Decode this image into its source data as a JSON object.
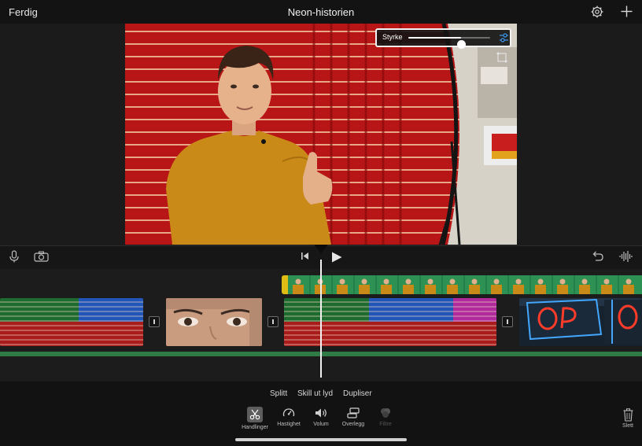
{
  "header": {
    "done_label": "Ferdig",
    "title": "Neon-historien"
  },
  "viewer": {
    "strength_label": "Styrke",
    "strength_value": 0.64
  },
  "clip_actions": [
    "Splitt",
    "Skill ut lyd",
    "Dupliser"
  ],
  "tools": [
    {
      "label": "Handlinger",
      "icon": "scissors-icon",
      "selected": true,
      "enabled": true
    },
    {
      "label": "Hastighet",
      "icon": "speedometer-icon",
      "selected": false,
      "enabled": true
    },
    {
      "label": "Volum",
      "icon": "speaker-icon",
      "selected": false,
      "enabled": true
    },
    {
      "label": "Overlegg",
      "icon": "overlay-icon",
      "selected": false,
      "enabled": true
    },
    {
      "label": "Filtre",
      "icon": "filters-icon",
      "selected": false,
      "enabled": false
    }
  ],
  "delete_label": "Slett",
  "colors": {
    "accent": "#e0bc14",
    "audio_track": "#2f7a45",
    "neon_red": "#c41a1a",
    "shirt": "#c98a18"
  }
}
